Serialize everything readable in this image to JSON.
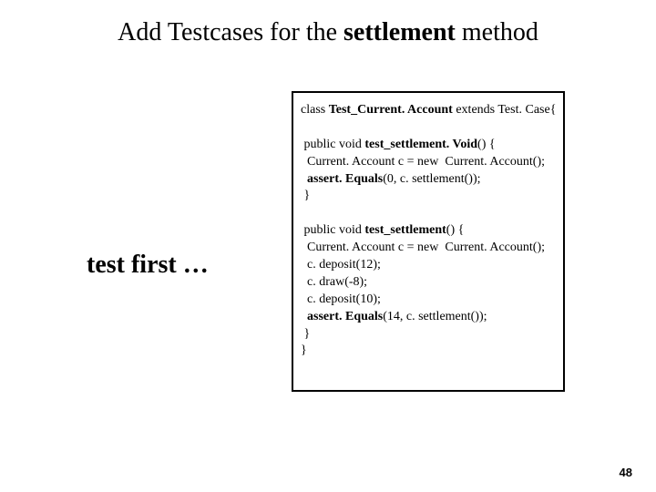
{
  "title": {
    "pre": "Add Testcases for the ",
    "bold": "settlement",
    "post": " method"
  },
  "subheading": "test first …",
  "code": {
    "l1": {
      "a": "class ",
      "b": "Test_Current. Account",
      "c": " extends Test. Case{"
    },
    "blank": " ",
    "l2": {
      "a": " public void ",
      "b": "test_settlement. Void",
      "c": "() {"
    },
    "l3": "  Current. Account c = new  Current. Account();",
    "l4": {
      "a": "  ",
      "b": "assert. Equals",
      "c": "(0, c. settlement());"
    },
    "l5": " }",
    "l6": {
      "a": " public void ",
      "b": "test_settlement",
      "c": "() {"
    },
    "l7": "  Current. Account c = new  Current. Account();",
    "l8": "  c. deposit(12);",
    "l9": "  c. draw(-8);",
    "l10": "  c. deposit(10);",
    "l11": {
      "a": "  ",
      "b": "assert. Equals",
      "c": "(14, c. settlement());"
    },
    "l12": " }",
    "l13": "}"
  },
  "page_number": "48"
}
